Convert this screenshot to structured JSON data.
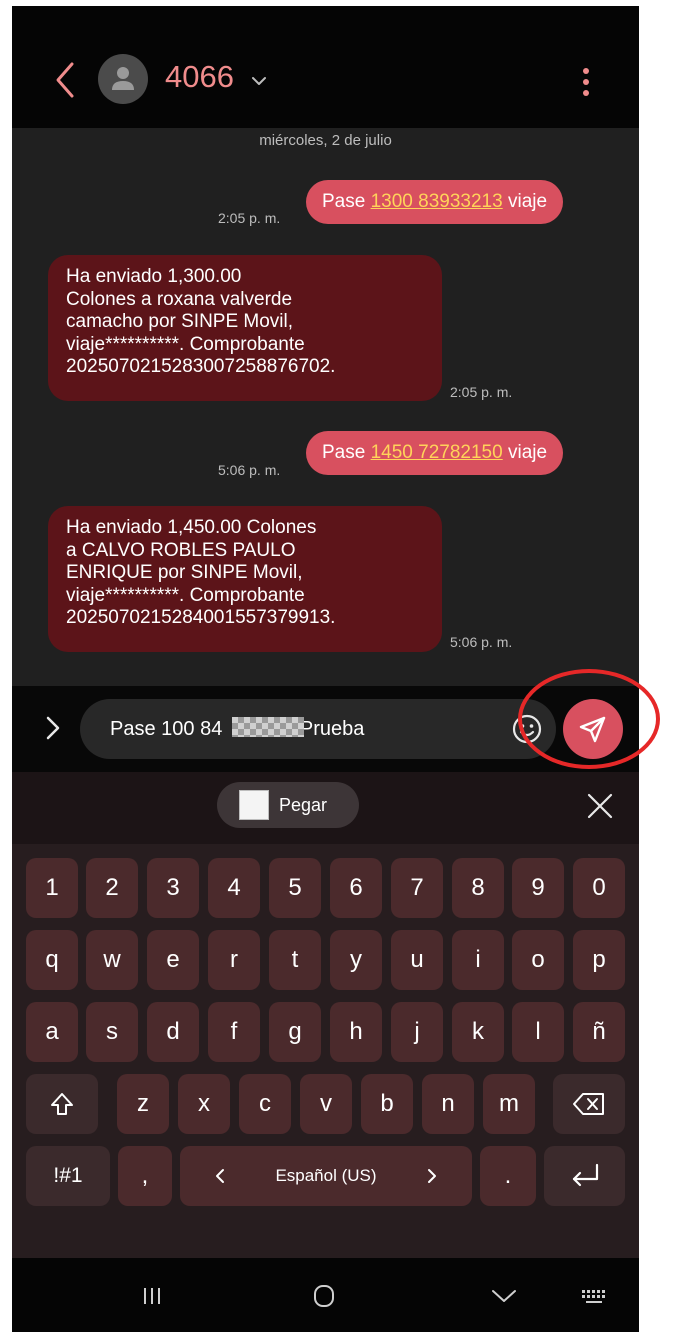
{
  "header": {
    "contact_name": "4066",
    "icons": {
      "back": "arrow-left-icon",
      "avatar": "person-icon",
      "chevron": "chevron-down-icon",
      "more": "more-vert-icon"
    }
  },
  "conversation": {
    "date_label": "miércoles, 2 de julio",
    "messages": [
      {
        "direction": "outgoing",
        "text_before": "Pase ",
        "link": "1300 83933213",
        "text_after": " viaje",
        "time": "2:05 p. m."
      },
      {
        "direction": "incoming",
        "lines": [
          "Ha enviado 1,300.00",
          "Colones a roxana valverde",
          "camacho por SINPE Movil,",
          "viaje**********. Comprobante",
          "2025070215283007258876702."
        ],
        "time": "2:05 p. m."
      },
      {
        "direction": "outgoing",
        "text_before": "Pase ",
        "link": "1450 72782150",
        "text_after": " viaje",
        "time": "5:06 p. m."
      },
      {
        "direction": "incoming",
        "lines": [
          "Ha enviado 1,450.00 Colones",
          "a CALVO ROBLES PAULO",
          "ENRIQUE por SINPE Movil,",
          "viaje**********. Comprobante",
          "2025070215284001557379913."
        ],
        "time": "5:06 p. m."
      }
    ]
  },
  "composer": {
    "text_before": "Pase 100 84",
    "text_after": " Prueba",
    "icons": {
      "expand": "chevron-right-icon",
      "emoji": "smiley-icon",
      "send": "send-icon"
    }
  },
  "clipboard": {
    "paste_label": "Pegar",
    "icons": {
      "close": "close-icon"
    }
  },
  "keyboard": {
    "rows": [
      [
        "1",
        "2",
        "3",
        "4",
        "5",
        "6",
        "7",
        "8",
        "9",
        "0"
      ],
      [
        "q",
        "w",
        "e",
        "r",
        "t",
        "y",
        "u",
        "i",
        "o",
        "p"
      ],
      [
        "a",
        "s",
        "d",
        "f",
        "g",
        "h",
        "j",
        "k",
        "l",
        "ñ"
      ],
      [
        "z",
        "x",
        "c",
        "v",
        "b",
        "n",
        "m"
      ]
    ],
    "symbols_key": "!#1",
    "comma_key": ",",
    "period_key": ".",
    "language": "Español (US)",
    "icons": {
      "shift": "shift-icon",
      "backspace": "backspace-icon",
      "enter": "enter-icon",
      "lang_left": "chevron-left-icon",
      "lang_right": "chevron-right-icon"
    }
  },
  "navbar": {
    "icons": {
      "recents": "recents-icon",
      "home": "home-icon",
      "back": "nav-back-icon",
      "keyboard": "keyboard-icon"
    }
  },
  "colors": {
    "accent": "#d8505f",
    "incoming_bubble": "#5c1419",
    "link": "#ffd35a",
    "highlight": "#e62828"
  }
}
